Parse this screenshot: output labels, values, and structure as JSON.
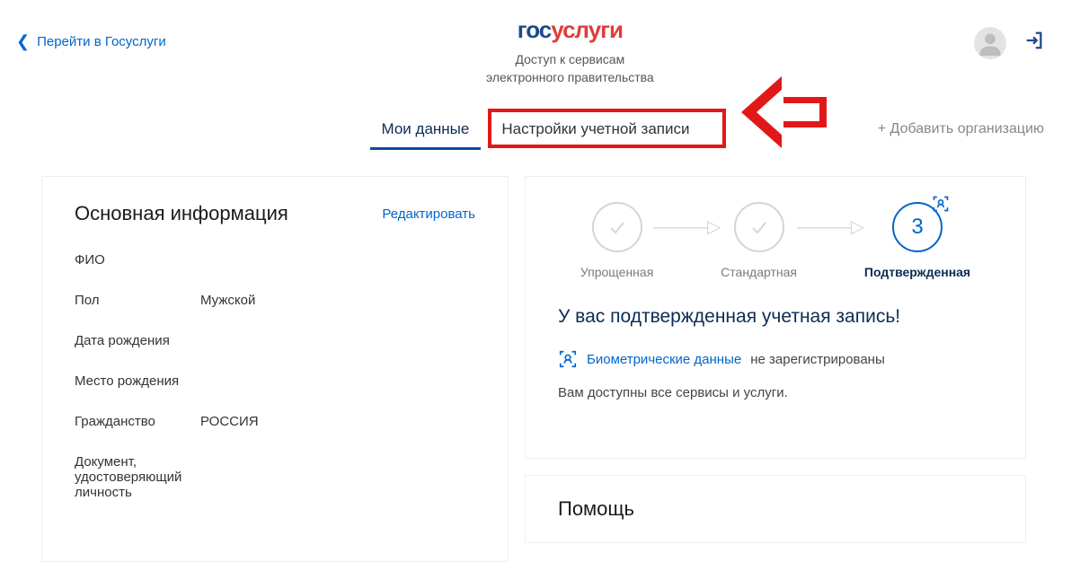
{
  "header": {
    "back_link": "Перейти в Госуслуги",
    "logo_part1": "гос",
    "logo_part2": "услуги",
    "subtitle_line1": "Доступ к сервисам",
    "subtitle_line2": "электронного правительства"
  },
  "tabs": {
    "my_data": "Мои данные",
    "account_settings": "Настройки учетной записи",
    "add_org": "+ Добавить организацию"
  },
  "basic_info": {
    "title": "Основная информация",
    "edit": "Редактировать",
    "rows": {
      "fio_label": "ФИО",
      "fio_value": "",
      "gender_label": "Пол",
      "gender_value": "Мужской",
      "birthdate_label": "Дата рождения",
      "birthdate_value": "",
      "birthplace_label": "Место рождения",
      "birthplace_value": "",
      "citizenship_label": "Гражданство",
      "citizenship_value": "РОССИЯ",
      "document_label": "Документ, удостоверяющий личность",
      "document_value": ""
    }
  },
  "status": {
    "step1": "Упрощенная",
    "step2": "Стандартная",
    "step3": "Подтвержденная",
    "step3_num": "3",
    "confirmed_title": "У вас подтвержденная учетная запись!",
    "biometric_link": "Биометрические данные",
    "biometric_status": "не зарегистрированы",
    "services_text": "Вам доступны все сервисы и услуги."
  },
  "help": {
    "title": "Помощь"
  }
}
